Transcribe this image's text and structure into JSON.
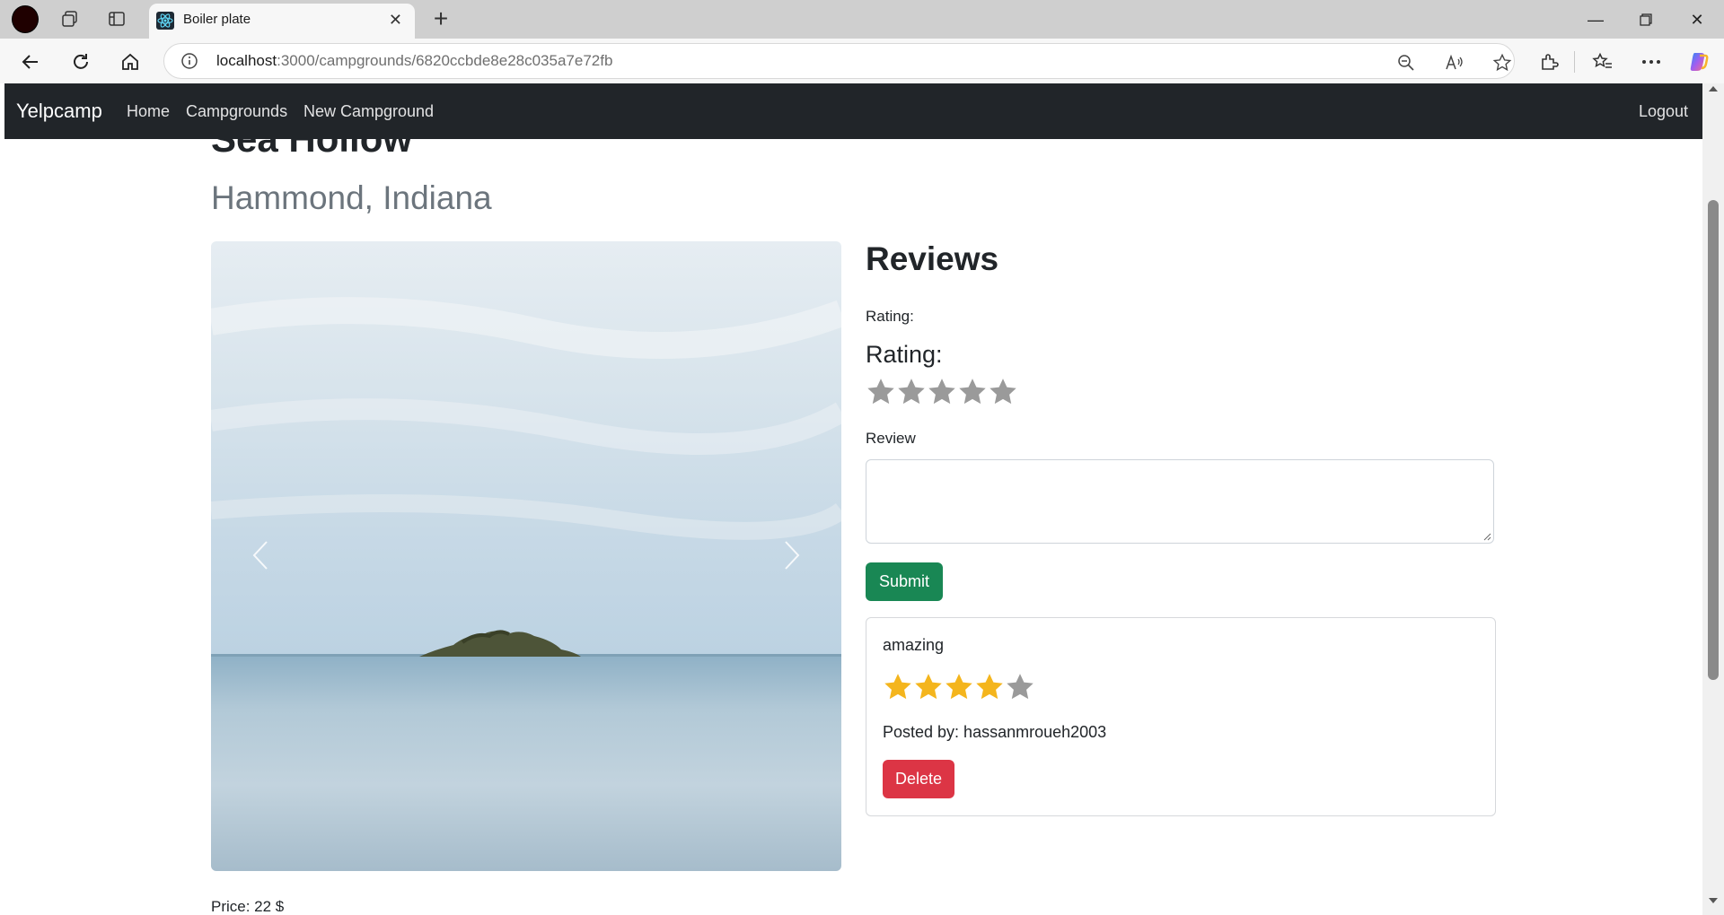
{
  "browser": {
    "tab_title": "Boiler plate",
    "url_host": "localhost",
    "url_path": ":3000/campgrounds/6820ccbde8e28c035a7e72fb"
  },
  "navbar": {
    "brand": "Yelpcamp",
    "links": [
      "Home",
      "Campgrounds",
      "New Campground"
    ],
    "logout": "Logout"
  },
  "campground": {
    "title": "Sea Hollow",
    "location": "Hammond, Indiana",
    "price_text": "Price: 22 $"
  },
  "reviews": {
    "heading": "Reviews",
    "rating_label": "Rating:",
    "rating_legend": "Rating:",
    "review_label": "Review",
    "textarea_value": "",
    "submit_label": "Submit",
    "rating_input_value": 0,
    "star_max": 5,
    "items": [
      {
        "body": "amazing",
        "rating": 4,
        "author_text": "Posted by: hassanmroueh2003",
        "delete_label": "Delete"
      }
    ]
  },
  "colors": {
    "navbar_bg": "#212529",
    "submit_bg": "#198754",
    "delete_bg": "#dc3545",
    "star_filled": "#f4b51d",
    "star_empty": "#9a9a9a"
  }
}
